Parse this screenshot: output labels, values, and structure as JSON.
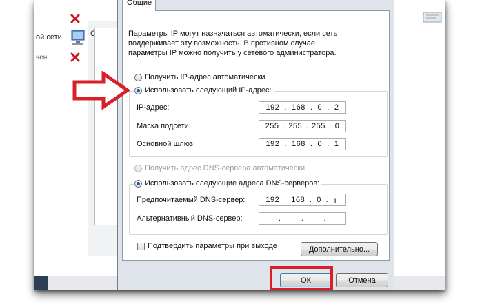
{
  "background": {
    "left_labels": [
      "ой сети",
      "чен"
    ],
    "inner_letter": "С"
  },
  "dialog": {
    "tab_label": "Общие",
    "intro_text": "Параметры IP могут назначаться автоматически, если сеть поддерживает эту возможность. В противном случае параметры IP можно получить у сетевого администратора.",
    "ip_auto_label": "Получить IP-адрес автоматически",
    "ip_manual_label": "Использовать следующий IP-адрес:",
    "fields": {
      "ip_label": "IP-адрес:",
      "ip_value": [
        "192",
        "168",
        "0",
        "2"
      ],
      "mask_label": "Маска подсети:",
      "mask_value": [
        "255",
        "255",
        "255",
        "0"
      ],
      "gateway_label": "Основной шлюз:",
      "gateway_value": [
        "192",
        "168",
        "0",
        "1"
      ]
    },
    "dns_auto_label": "Получить адрес DNS-сервера автоматически",
    "dns_manual_label": "Использовать следующие адреса DNS-серверов:",
    "dns": {
      "preferred_label": "Предпочитаемый DNS-сервер:",
      "preferred_value": [
        "192",
        "168",
        "0",
        "1"
      ],
      "alternate_label": "Альтернативный DNS-сервер:",
      "alternate_value": [
        "",
        "",
        "",
        ""
      ]
    },
    "validate_label": "Подтвердить параметры при выходе",
    "advanced_button": "Дополнительно...",
    "ok_button": "ОК",
    "cancel_button": "Отмена"
  },
  "colors": {
    "highlight": "#d8202a",
    "radio_dot": "#1f4fb6"
  }
}
